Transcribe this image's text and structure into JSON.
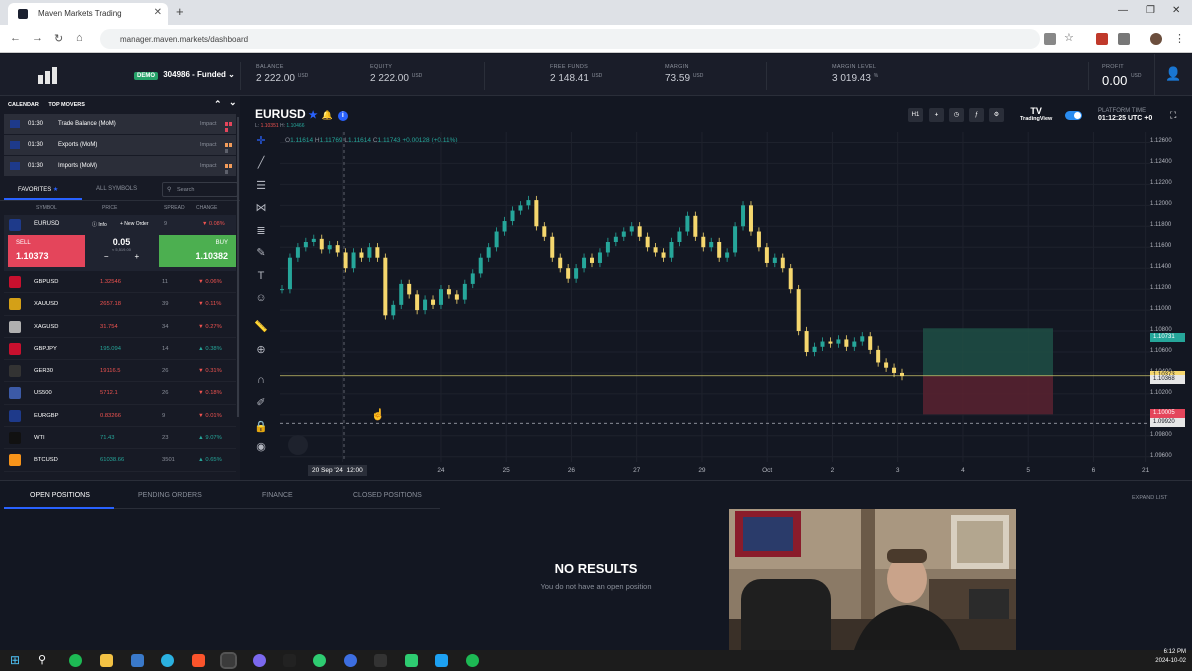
{
  "browser": {
    "tab_title": "Maven Markets Trading",
    "url": "manager.maven.markets/dashboard"
  },
  "header": {
    "account_badge": "DEMO",
    "account_label": "304986 - Funded",
    "stats": [
      {
        "label": "BALANCE",
        "value": "2 222.00",
        "unit": "USD"
      },
      {
        "label": "EQUITY",
        "value": "2 222.00",
        "unit": "USD"
      },
      {
        "label": "FREE FUNDS",
        "value": "2 148.41",
        "unit": "USD"
      },
      {
        "label": "MARGIN",
        "value": "73.59",
        "unit": "USD"
      },
      {
        "label": "MARGIN LEVEL",
        "value": "3 019.43",
        "unit": "%"
      }
    ],
    "profit": {
      "label": "PROFIT",
      "value": "0.00",
      "unit": "USD"
    }
  },
  "left": {
    "tabs": [
      "CALENDAR",
      "TOP MOVERS"
    ],
    "news": [
      {
        "time": "01:30",
        "event": "Trade Balance (MoM)",
        "impact": "Impact",
        "level": 3
      },
      {
        "time": "01:30",
        "event": "Exports (MoM)",
        "impact": "Impact",
        "level": 2
      },
      {
        "time": "01:30",
        "event": "Imports (MoM)",
        "impact": "Impact",
        "level": 2
      }
    ],
    "fav_tab": "FAVORITES",
    "all_tab": "ALL SYMBOLS",
    "search_placeholder": "Search",
    "columns": [
      "SYMBOL",
      "PRICE",
      "SPREAD",
      "CHANGE"
    ],
    "selected": {
      "symbol": "EURUSD",
      "info": "Info",
      "new_order": "+ New Order",
      "spread": "9",
      "change": "0.08%",
      "sell_label": "SELL",
      "sell_price": "1.10373",
      "buy_label": "BUY",
      "buy_price": "1.10382",
      "lot": "0.05",
      "lot_sub": "≈ 5,519.00",
      "minus": "−",
      "plus": "+"
    },
    "symbols": [
      {
        "name": "GBPUSD",
        "price": "1.32546",
        "spread": "11",
        "change": "0.06%",
        "dir": "dn",
        "color": "#c8102e"
      },
      {
        "name": "XAUUSD",
        "price": "2657.18",
        "spread": "39",
        "change": "0.11%",
        "dir": "dn",
        "color": "#d4a017"
      },
      {
        "name": "XAGUSD",
        "price": "31.754",
        "spread": "34",
        "change": "0.27%",
        "dir": "dn",
        "color": "#b0b0b0"
      },
      {
        "name": "GBPJPY",
        "price": "195.094",
        "spread": "14",
        "change": "0.38%",
        "dir": "up",
        "color": "#c8102e"
      },
      {
        "name": "GER30",
        "price": "19116.5",
        "spread": "26",
        "change": "0.31%",
        "dir": "dn",
        "color": "#333333"
      },
      {
        "name": "US500",
        "price": "5712.1",
        "spread": "26",
        "change": "0.18%",
        "dir": "dn",
        "color": "#3c5aa6"
      },
      {
        "name": "EURGBP",
        "price": "0.83266",
        "spread": "9",
        "change": "0.01%",
        "dir": "dn",
        "color": "#1e3a8a"
      },
      {
        "name": "WTI",
        "price": "71.43",
        "spread": "23",
        "change": "9.07%",
        "dir": "up",
        "color": "#111111"
      },
      {
        "name": "BTCUSD",
        "price": "61038.66",
        "spread": "3501",
        "change": "0.65%",
        "dir": "up",
        "color": "#f7931a"
      }
    ]
  },
  "chart": {
    "symbol": "EURUSD",
    "lh": {
      "l_label": "L:",
      "l_val": "1.10351",
      "h_label": "H:",
      "h_val": "1.10466"
    },
    "ohlc": {
      "o": "1.11614",
      "h": "1.11769",
      "l": "1.11614",
      "c": "1.11743",
      "chg": "+0.00128 (+0.11%)"
    },
    "timeframe": "H1",
    "tradingview": "TradingView",
    "platform_time_label": "PLATFORM TIME",
    "platform_time": "01:12:25 UTC +0",
    "price_labels": {
      "tp": "1.10731",
      "bid": "1.10373",
      "ask": "1.10368",
      "sl": "1.10005",
      "dash": "1.09920"
    },
    "x_highlight": "20 Sep '24",
    "x_highlight_time": "12:00"
  },
  "chart_data": {
    "type": "candlestick",
    "title": "EURUSD",
    "x": [
      "20 Sep '24",
      "24",
      "25",
      "26",
      "27",
      "29",
      "Oct",
      "2",
      "3",
      "4",
      "5",
      "6",
      "21"
    ],
    "y_ticks": [
      "1.12600",
      "1.12400",
      "1.12200",
      "1.12000",
      "1.11800",
      "1.11600",
      "1.11400",
      "1.11200",
      "1.11000",
      "1.10800",
      "1.10600",
      "1.10400",
      "1.10200",
      "1.10000",
      "1.09800",
      "1.09600"
    ],
    "ylim": [
      1.0955,
      1.127
    ],
    "series": [
      {
        "values": [
          1.112,
          1.115,
          1.116,
          1.1165,
          1.1168,
          1.1158,
          1.1162,
          1.1155,
          1.114,
          1.1155,
          1.115,
          1.116,
          1.115,
          1.1095,
          1.1105,
          1.1125,
          1.1115,
          1.11,
          1.111,
          1.1105,
          1.112,
          1.1115,
          1.111,
          1.1125,
          1.1135,
          1.115,
          1.116,
          1.1175,
          1.1185,
          1.1195,
          1.12,
          1.1205,
          1.118,
          1.117,
          1.115,
          1.114,
          1.113,
          1.114,
          1.115,
          1.1145,
          1.1155,
          1.1165,
          1.117,
          1.1175,
          1.118,
          1.117,
          1.116,
          1.1155,
          1.115,
          1.1165,
          1.1175,
          1.119,
          1.117,
          1.116,
          1.1165,
          1.115,
          1.1155,
          1.118,
          1.12,
          1.1175,
          1.116,
          1.1145,
          1.115,
          1.114,
          1.112,
          1.108,
          1.106,
          1.1065,
          1.107,
          1.1068,
          1.1072,
          1.1065,
          1.107,
          1.1075,
          1.1062,
          1.105,
          1.1045,
          1.104,
          1.1037
        ]
      }
    ],
    "levels": {
      "take_profit": 1.10731,
      "entry": 1.10373,
      "stop_loss": 1.10005
    }
  },
  "bottom": {
    "tabs": [
      "OPEN POSITIONS",
      "PENDING ORDERS",
      "FINANCE",
      "CLOSED POSITIONS"
    ],
    "expand": "EXPAND LIST",
    "empty_title": "NO RESULTS",
    "empty_sub": "You do not have an open position"
  },
  "taskbar": {
    "time": "6:12 PM",
    "date": "2024-10-02"
  }
}
